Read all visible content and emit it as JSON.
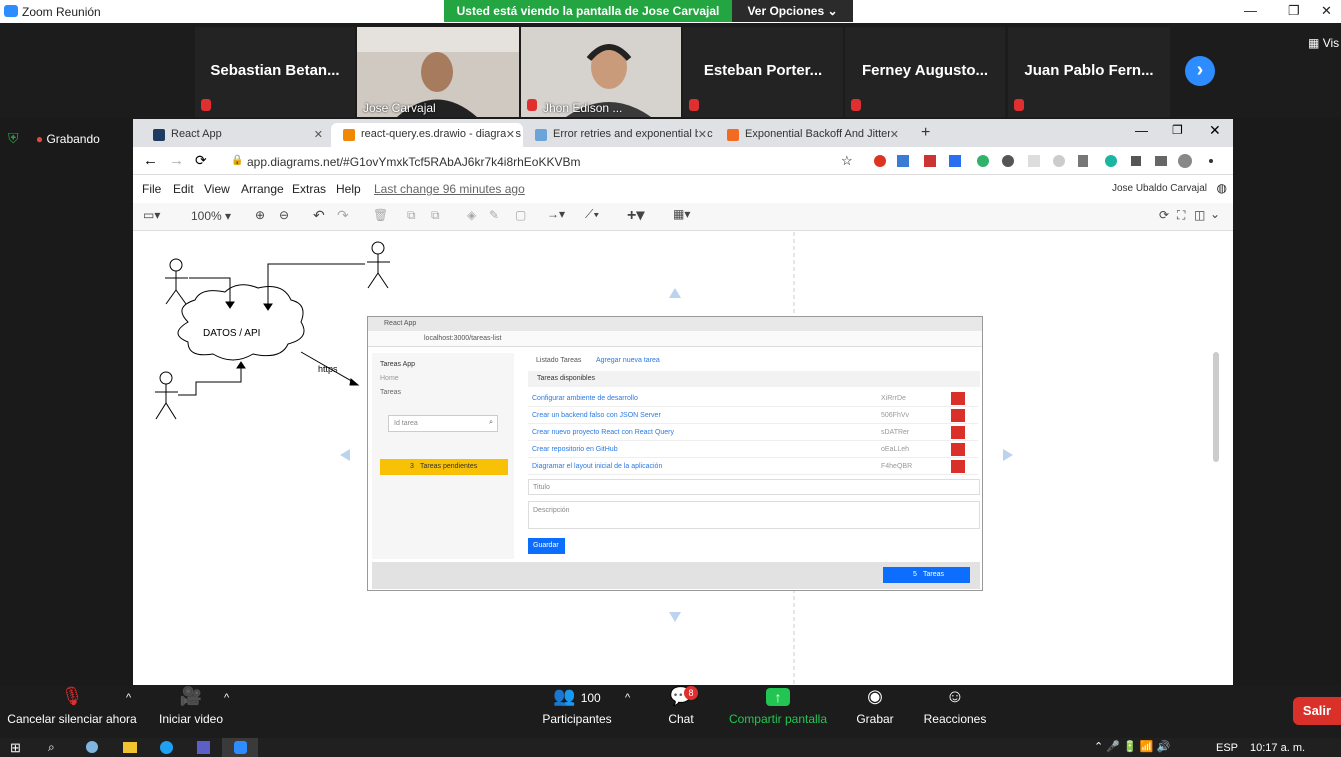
{
  "zoom": {
    "window_title": "Zoom Reunión",
    "banner": "Usted está viendo la pantalla de Jose Carvajal",
    "view_options": "Ver Opciones",
    "view_corner": "Vis",
    "recording": "Grabando",
    "participants_tiles": [
      {
        "name": "Sebastian Betan..."
      },
      {
        "name": "Jose Carvajal"
      },
      {
        "name": "Jhon Edison ..."
      },
      {
        "name": "Esteban Porter..."
      },
      {
        "name": "Ferney Augusto..."
      },
      {
        "name": "Juan Pablo Fern..."
      }
    ],
    "controls": {
      "mute": "Cancelar silenciar ahora",
      "video": "Iniciar video",
      "participants": "Participantes",
      "participants_count": "100",
      "chat": "Chat",
      "chat_badge": "8",
      "share": "Compartir pantalla",
      "record": "Grabar",
      "reactions": "Reacciones",
      "leave": "Salir"
    }
  },
  "browser": {
    "tabs": [
      {
        "label": "React App",
        "color": "#1e3a5f"
      },
      {
        "label": "react-query.es.drawio - diagrams",
        "color": "#f08705"
      },
      {
        "label": "Error retries and exponential bac",
        "color": "#6aa4d8"
      },
      {
        "label": "Exponential Backoff And Jitter | ",
        "color": "#f26b21"
      }
    ],
    "url": "app.diagrams.net/#G1ovYmxkTcf5RAbAJ6kr7k4i8rhEoKKVBm"
  },
  "drawio": {
    "menu": [
      "File",
      "Edit",
      "View",
      "Arrange",
      "Extras",
      "Help"
    ],
    "last_change": "Last change 96 minutes ago",
    "user": "Jose Ubaldo Carvajal",
    "zoom": "100%",
    "cloud_label": "DATOS / API",
    "edge_label": "https"
  },
  "embedded_app": {
    "tab": "React App",
    "url": "localhost:3000/tareas-list",
    "brand": "Tareas App",
    "nav": [
      "Home",
      "Tareas"
    ],
    "search_placeholder": "Id tarea",
    "pending_count": "3",
    "pending_label": "Tareas pendientes",
    "tab_list": "Listado Tareas",
    "tab_add": "Agregar nueva tarea",
    "section": "Tareas disponibles",
    "tasks": [
      {
        "title": "Configurar ambiente de desarrollo",
        "id": "XiRrrDe"
      },
      {
        "title": "Crear un backend falso con JSON Server",
        "id": "506FhVv"
      },
      {
        "title": "Crear nuevo proyecto React con React Query",
        "id": "sDATRer"
      },
      {
        "title": "Crear repositorio en GitHub",
        "id": "oEaLLeh"
      },
      {
        "title": "Diagramar el layout inicial de la aplicación",
        "id": "F4heQBR"
      }
    ],
    "title_placeholder": "Titulo",
    "desc_placeholder": "Descripción",
    "save": "Guardar",
    "footer_count": "5",
    "footer_label": "Tareas"
  },
  "taskbar": {
    "lang": "ESP",
    "time": "10:17 a. m."
  }
}
